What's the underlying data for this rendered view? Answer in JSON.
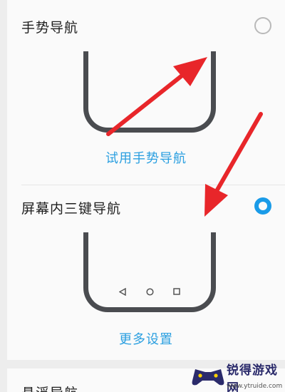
{
  "options": [
    {
      "title": "手势导航",
      "selected": false,
      "link_label": "试用手势导航"
    },
    {
      "title": "屏幕内三键导航",
      "selected": true,
      "link_label": "更多设置"
    },
    {
      "title": "悬浮导航"
    }
  ],
  "watermark": {
    "text": "锐得游戏网",
    "url": "www.ytruide.com"
  },
  "colors": {
    "accent": "#1a9be8",
    "link": "#2a9fe0",
    "arrow": "#e8262a",
    "phone_frame": "#4a4c50"
  },
  "icons": [
    "back-triangle-icon",
    "home-circle-icon",
    "recents-square-icon",
    "red-arrow-icon",
    "gamepad-logo-icon"
  ]
}
